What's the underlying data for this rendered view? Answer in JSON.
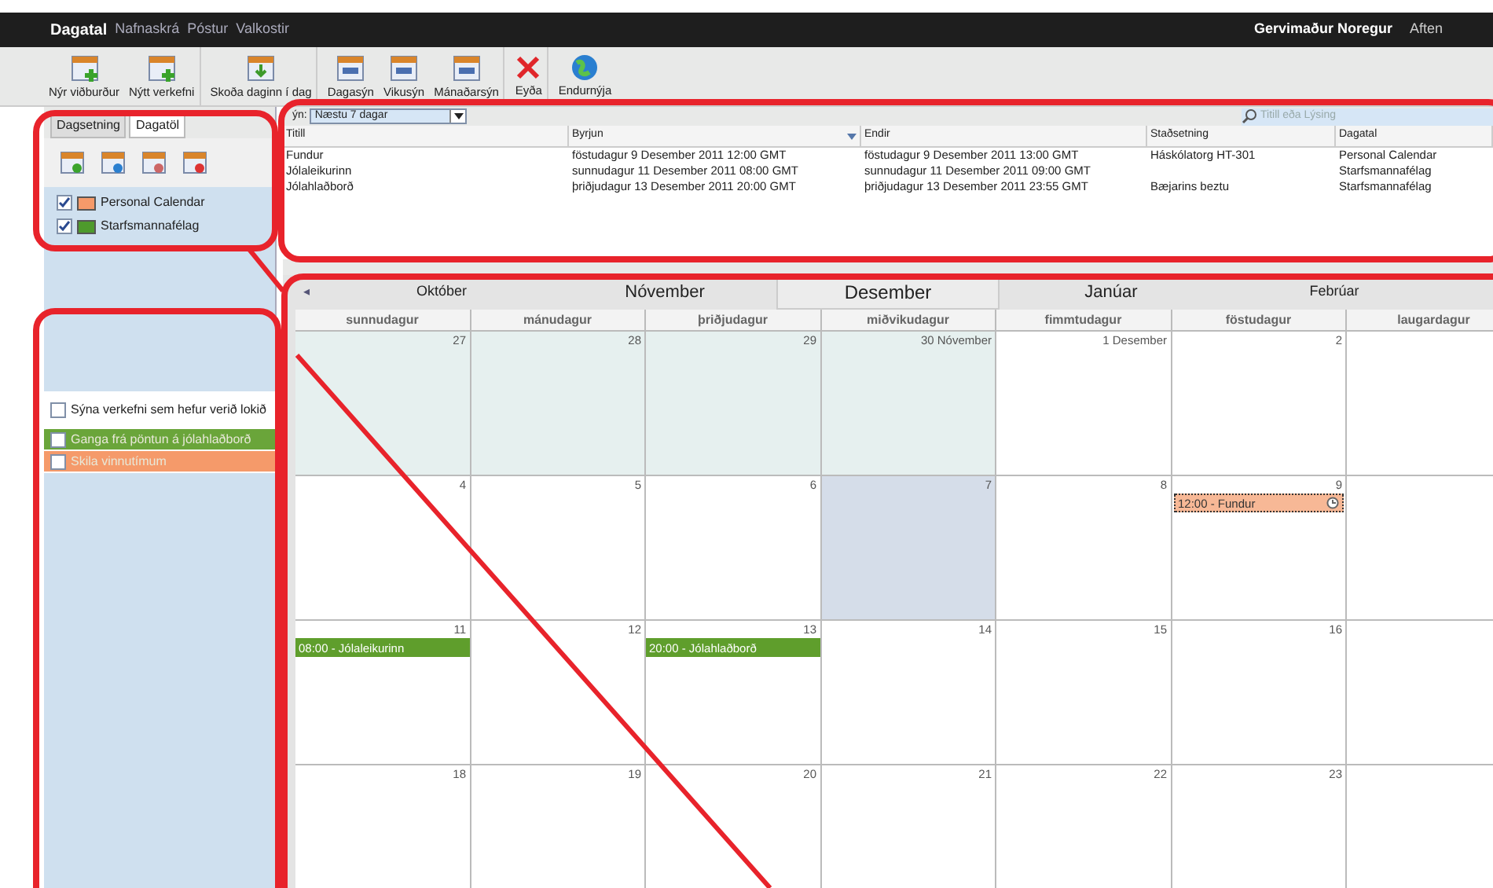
{
  "nav": {
    "tabs": [
      {
        "label": "Dagatal",
        "selected": true
      },
      {
        "label": "Nafnaskrá",
        "selected": false
      },
      {
        "label": "Póstur",
        "selected": false
      },
      {
        "label": "Valkostir",
        "selected": false
      }
    ],
    "user": "Gervimaður Noregur",
    "user_link": "Aften"
  },
  "toolbar": [
    {
      "label": "Nýr viðburður",
      "kind": "add"
    },
    {
      "label": "Nýtt verkefni",
      "kind": "task"
    },
    {
      "label": "Skoða daginn í dag",
      "kind": "today"
    },
    {
      "label": "Dagasýn",
      "kind": "day"
    },
    {
      "label": "Vikusýn",
      "kind": "week"
    },
    {
      "label": "Mánaðarsýn",
      "kind": "month"
    },
    {
      "label": "Eyða",
      "kind": "delete"
    },
    {
      "label": "Endurnýja",
      "kind": "refresh"
    }
  ],
  "sidebar": {
    "tabs": [
      {
        "label": "Dagsetning",
        "selected": false
      },
      {
        "label": "Dagatöl",
        "selected": true
      }
    ],
    "calendars": [
      {
        "name": "Personal Calendar",
        "checked": true,
        "color": "#f59a6a"
      },
      {
        "name": "Starfsmannafélag",
        "checked": true,
        "color": "#4e9a2c"
      }
    ],
    "show_completed": {
      "label": "Sýna verkefni sem hefur verið lokið",
      "checked": false
    },
    "tasks": [
      {
        "title": "Ganga frá pöntun á jólahlaðborð",
        "checked": false,
        "color": "#6aa53a"
      },
      {
        "title": "Skila vinnutímum",
        "checked": false,
        "color": "#f59a6a"
      }
    ]
  },
  "list": {
    "view_label": "ýn:",
    "view_value": "Næstu 7 dagar",
    "search_placeholder": "Titill eða Lýsing",
    "columns": [
      {
        "label": "Titill",
        "sorted": false
      },
      {
        "label": "Byrjun",
        "sorted": true
      },
      {
        "label": "Endir",
        "sorted": false
      },
      {
        "label": "Staðsetning",
        "sorted": false
      },
      {
        "label": "Dagatal",
        "sorted": false
      }
    ],
    "rows": [
      [
        "Fundur",
        "föstudagur 9 Desember 2011 12:00 GMT",
        "föstudagur 9 Desember 2011 13:00 GMT",
        "Háskólatorg HT-301",
        "Personal Calendar"
      ],
      [
        "Jólaleikurinn",
        "sunnudagur 11 Desember 2011 08:00 GMT",
        "sunnudagur 11 Desember 2011 09:00 GMT",
        "",
        "Starfsmannafélag"
      ],
      [
        "Jólahlaðborð",
        "þriðjudagur 13 Desember 2011 20:00 GMT",
        "þriðjudagur 13 Desember 2011 23:55 GMT",
        "Bæjarins beztu",
        "Starfsmannafélag"
      ]
    ]
  },
  "month": {
    "prev": "◂",
    "months": [
      {
        "label": "Október",
        "selected": false
      },
      {
        "label": "Nóvember",
        "selected": false
      },
      {
        "label": "Desember",
        "selected": true
      },
      {
        "label": "Janúar",
        "selected": false
      },
      {
        "label": "Febrúar",
        "selected": false
      }
    ],
    "weekdays": [
      "sunnudagur",
      "mánudagur",
      "þriðjudagur",
      "miðvikudagur",
      "fimmtudagur",
      "föstudagur",
      "laugardagur"
    ],
    "weeks": [
      [
        {
          "label": "27",
          "kind": "other"
        },
        {
          "label": "28",
          "kind": "other"
        },
        {
          "label": "29",
          "kind": "other"
        },
        {
          "label": "30 Nóvember",
          "kind": "other"
        },
        {
          "label": "1 Desember",
          "kind": "normal"
        },
        {
          "label": "2",
          "kind": "normal"
        }
      ],
      [
        {
          "label": "4",
          "kind": "normal"
        },
        {
          "label": "5",
          "kind": "normal"
        },
        {
          "label": "6",
          "kind": "normal"
        },
        {
          "label": "7",
          "kind": "today"
        },
        {
          "label": "8",
          "kind": "normal"
        },
        {
          "label": "9",
          "kind": "normal",
          "events": [
            {
              "title": "12:00 - Fundur",
              "color": "#f7b896",
              "selected": true
            }
          ]
        }
      ],
      [
        {
          "label": "11",
          "kind": "normal",
          "events": [
            {
              "title": "08:00 - Jólaleikurinn",
              "color": "#5f9e2c",
              "selected": false
            }
          ]
        },
        {
          "label": "12",
          "kind": "normal"
        },
        {
          "label": "13",
          "kind": "normal",
          "events": [
            {
              "title": "20:00 - Jólahlaðborð",
              "color": "#5f9e2c",
              "selected": false
            }
          ]
        },
        {
          "label": "14",
          "kind": "normal"
        },
        {
          "label": "15",
          "kind": "normal"
        },
        {
          "label": "16",
          "kind": "normal"
        }
      ],
      [
        {
          "label": "18",
          "kind": "normal"
        },
        {
          "label": "19",
          "kind": "normal"
        },
        {
          "label": "20",
          "kind": "normal"
        },
        {
          "label": "21",
          "kind": "normal"
        },
        {
          "label": "22",
          "kind": "normal"
        },
        {
          "label": "23",
          "kind": "normal"
        }
      ]
    ]
  }
}
